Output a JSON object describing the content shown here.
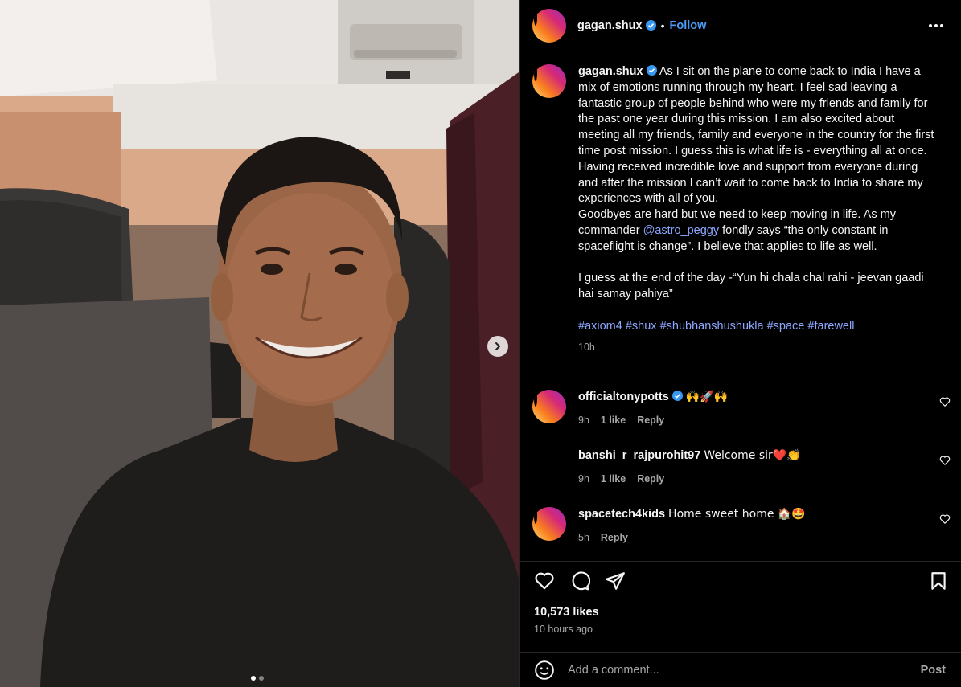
{
  "post": {
    "username": "gagan.shux",
    "separator": "•",
    "follow_label": "Follow",
    "caption_lines": [
      "As I sit on the plane to come back to India I have a mix of emotions running through my heart. I feel sad leaving a fantastic group of people behind who were my friends and family for the past one year during this mission. I am also excited about meeting all my friends, family and everyone in the country for the first time post mission. I guess this is what life is - everything all at once.",
      "Having received incredible love and support from everyone during and after the mission I can’t wait to come back to India to share my experiences with all of you.",
      "Goodbyes are hard but we need to keep moving in life. As my commander ",
      "@astro_peggy",
      " fondly says “the only constant in spaceflight is change”. I believe that applies to life as well.",
      "",
      "I guess at the end of the day -“Yun hi chala chal rahi - jeevan gaadi hai samay pahiya”",
      ""
    ],
    "hashtags": [
      "#axiom4",
      "#shux",
      "#shubhanshushukla",
      "#space",
      "#farewell"
    ],
    "caption_time": "10h",
    "likes": "10,573 likes",
    "posted_ago": "10 hours ago"
  },
  "comments": [
    {
      "username": "officialtonypotts",
      "verified": true,
      "text": "🙌🚀🙌",
      "time": "9h",
      "likes": "1 like",
      "reply": "Reply"
    },
    {
      "username": "banshi_r_rajpurohit97",
      "verified": false,
      "text": "Welcome sir❤️👏",
      "time": "9h",
      "likes": "1 like",
      "reply": "Reply"
    },
    {
      "username": "spacetech4kids",
      "verified": false,
      "text": "Home sweet home 🏠🤩",
      "time": "5h",
      "likes": "",
      "reply": "Reply"
    }
  ],
  "composer": {
    "placeholder": "Add a comment...",
    "post_label": "Post"
  },
  "carousel": {
    "current": 1,
    "total": 2
  },
  "colors": {
    "accent": "#0095f6",
    "link": "#8ea8ff",
    "background": "#000000",
    "muted": "#a8a8a8"
  },
  "icons": [
    "more-options-icon",
    "verified-badge-icon",
    "heart-icon",
    "comment-icon",
    "share-icon",
    "save-icon",
    "emoji-icon",
    "chevron-right-icon"
  ]
}
